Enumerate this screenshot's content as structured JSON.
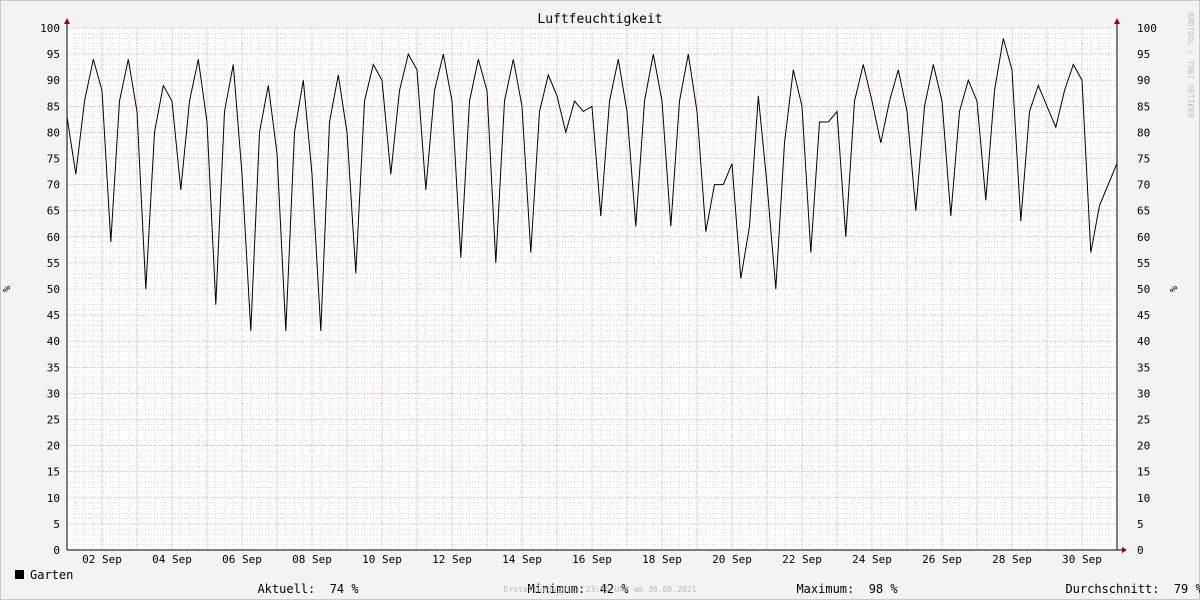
{
  "chart_data": {
    "type": "line",
    "title": "Luftfeuchtigkeit",
    "ylabel": "%",
    "ylabel_right": "%",
    "ylim": [
      0,
      100
    ],
    "xlim": [
      "2021-09-01",
      "2021-10-01"
    ],
    "y_ticks": [
      0,
      5,
      10,
      15,
      20,
      25,
      30,
      35,
      40,
      45,
      50,
      55,
      60,
      65,
      70,
      75,
      80,
      85,
      90,
      95,
      100
    ],
    "x_ticks": [
      {
        "date": "2021-09-02",
        "label": "02 Sep"
      },
      {
        "date": "2021-09-04",
        "label": "04 Sep"
      },
      {
        "date": "2021-09-06",
        "label": "06 Sep"
      },
      {
        "date": "2021-09-08",
        "label": "08 Sep"
      },
      {
        "date": "2021-09-10",
        "label": "10 Sep"
      },
      {
        "date": "2021-09-12",
        "label": "12 Sep"
      },
      {
        "date": "2021-09-14",
        "label": "14 Sep"
      },
      {
        "date": "2021-09-16",
        "label": "16 Sep"
      },
      {
        "date": "2021-09-18",
        "label": "18 Sep"
      },
      {
        "date": "2021-09-20",
        "label": "20 Sep"
      },
      {
        "date": "2021-09-22",
        "label": "22 Sep"
      },
      {
        "date": "2021-09-24",
        "label": "24 Sep"
      },
      {
        "date": "2021-09-26",
        "label": "26 Sep"
      },
      {
        "date": "2021-09-28",
        "label": "28 Sep"
      },
      {
        "date": "2021-09-30",
        "label": "30 Sep"
      }
    ],
    "grid": true,
    "series": [
      {
        "name": "Garten",
        "color": "#000000",
        "points": [
          [
            "2021-09-01 00:00",
            83
          ],
          [
            "2021-09-01 06:00",
            72
          ],
          [
            "2021-09-01 12:00",
            86
          ],
          [
            "2021-09-01 18:00",
            94
          ],
          [
            "2021-09-02 00:00",
            88
          ],
          [
            "2021-09-02 06:00",
            59
          ],
          [
            "2021-09-02 12:00",
            86
          ],
          [
            "2021-09-02 18:00",
            94
          ],
          [
            "2021-09-03 00:00",
            84
          ],
          [
            "2021-09-03 06:00",
            50
          ],
          [
            "2021-09-03 12:00",
            80
          ],
          [
            "2021-09-03 18:00",
            89
          ],
          [
            "2021-09-04 00:00",
            86
          ],
          [
            "2021-09-04 06:00",
            69
          ],
          [
            "2021-09-04 12:00",
            86
          ],
          [
            "2021-09-04 18:00",
            94
          ],
          [
            "2021-09-05 00:00",
            82
          ],
          [
            "2021-09-05 06:00",
            47
          ],
          [
            "2021-09-05 12:00",
            84
          ],
          [
            "2021-09-05 18:00",
            93
          ],
          [
            "2021-09-06 00:00",
            72
          ],
          [
            "2021-09-06 06:00",
            42
          ],
          [
            "2021-09-06 12:00",
            80
          ],
          [
            "2021-09-06 18:00",
            89
          ],
          [
            "2021-09-07 00:00",
            76
          ],
          [
            "2021-09-07 06:00",
            42
          ],
          [
            "2021-09-07 12:00",
            80
          ],
          [
            "2021-09-07 18:00",
            90
          ],
          [
            "2021-09-08 00:00",
            72
          ],
          [
            "2021-09-08 06:00",
            42
          ],
          [
            "2021-09-08 12:00",
            82
          ],
          [
            "2021-09-08 18:00",
            91
          ],
          [
            "2021-09-09 00:00",
            80
          ],
          [
            "2021-09-09 06:00",
            53
          ],
          [
            "2021-09-09 12:00",
            86
          ],
          [
            "2021-09-09 18:00",
            93
          ],
          [
            "2021-09-10 00:00",
            90
          ],
          [
            "2021-09-10 06:00",
            72
          ],
          [
            "2021-09-10 12:00",
            88
          ],
          [
            "2021-09-10 18:00",
            95
          ],
          [
            "2021-09-11 00:00",
            92
          ],
          [
            "2021-09-11 06:00",
            69
          ],
          [
            "2021-09-11 12:00",
            88
          ],
          [
            "2021-09-11 18:00",
            95
          ],
          [
            "2021-09-12 00:00",
            86
          ],
          [
            "2021-09-12 06:00",
            56
          ],
          [
            "2021-09-12 12:00",
            86
          ],
          [
            "2021-09-12 18:00",
            94
          ],
          [
            "2021-09-13 00:00",
            88
          ],
          [
            "2021-09-13 06:00",
            55
          ],
          [
            "2021-09-13 12:00",
            86
          ],
          [
            "2021-09-13 18:00",
            94
          ],
          [
            "2021-09-14 00:00",
            85
          ],
          [
            "2021-09-14 06:00",
            57
          ],
          [
            "2021-09-14 12:00",
            84
          ],
          [
            "2021-09-14 18:00",
            91
          ],
          [
            "2021-09-15 00:00",
            87
          ],
          [
            "2021-09-15 06:00",
            80
          ],
          [
            "2021-09-15 12:00",
            86
          ],
          [
            "2021-09-15 18:00",
            84
          ],
          [
            "2021-09-16 00:00",
            85
          ],
          [
            "2021-09-16 06:00",
            64
          ],
          [
            "2021-09-16 12:00",
            86
          ],
          [
            "2021-09-16 18:00",
            94
          ],
          [
            "2021-09-17 00:00",
            84
          ],
          [
            "2021-09-17 06:00",
            62
          ],
          [
            "2021-09-17 12:00",
            86
          ],
          [
            "2021-09-17 18:00",
            95
          ],
          [
            "2021-09-18 00:00",
            86
          ],
          [
            "2021-09-18 06:00",
            62
          ],
          [
            "2021-09-18 12:00",
            86
          ],
          [
            "2021-09-18 18:00",
            95
          ],
          [
            "2021-09-19 00:00",
            84
          ],
          [
            "2021-09-19 06:00",
            61
          ],
          [
            "2021-09-19 12:00",
            70
          ],
          [
            "2021-09-19 18:00",
            70
          ],
          [
            "2021-09-20 00:00",
            74
          ],
          [
            "2021-09-20 06:00",
            52
          ],
          [
            "2021-09-20 12:00",
            62
          ],
          [
            "2021-09-20 18:00",
            87
          ],
          [
            "2021-09-21 00:00",
            70
          ],
          [
            "2021-09-21 06:00",
            50
          ],
          [
            "2021-09-21 12:00",
            78
          ],
          [
            "2021-09-21 18:00",
            92
          ],
          [
            "2021-09-22 00:00",
            85
          ],
          [
            "2021-09-22 06:00",
            57
          ],
          [
            "2021-09-22 12:00",
            82
          ],
          [
            "2021-09-22 18:00",
            82
          ],
          [
            "2021-09-23 00:00",
            84
          ],
          [
            "2021-09-23 06:00",
            60
          ],
          [
            "2021-09-23 12:00",
            86
          ],
          [
            "2021-09-23 18:00",
            93
          ],
          [
            "2021-09-24 00:00",
            86
          ],
          [
            "2021-09-24 06:00",
            78
          ],
          [
            "2021-09-24 12:00",
            86
          ],
          [
            "2021-09-24 18:00",
            92
          ],
          [
            "2021-09-25 00:00",
            84
          ],
          [
            "2021-09-25 06:00",
            65
          ],
          [
            "2021-09-25 12:00",
            85
          ],
          [
            "2021-09-25 18:00",
            93
          ],
          [
            "2021-09-26 00:00",
            86
          ],
          [
            "2021-09-26 06:00",
            64
          ],
          [
            "2021-09-26 12:00",
            84
          ],
          [
            "2021-09-26 18:00",
            90
          ],
          [
            "2021-09-27 00:00",
            86
          ],
          [
            "2021-09-27 06:00",
            67
          ],
          [
            "2021-09-27 12:00",
            88
          ],
          [
            "2021-09-27 18:00",
            98
          ],
          [
            "2021-09-28 00:00",
            92
          ],
          [
            "2021-09-28 06:00",
            63
          ],
          [
            "2021-09-28 12:00",
            84
          ],
          [
            "2021-09-28 18:00",
            89
          ],
          [
            "2021-09-29 00:00",
            85
          ],
          [
            "2021-09-29 06:00",
            81
          ],
          [
            "2021-09-29 12:00",
            88
          ],
          [
            "2021-09-29 18:00",
            93
          ],
          [
            "2021-09-30 00:00",
            90
          ],
          [
            "2021-09-30 06:00",
            57
          ],
          [
            "2021-09-30 12:00",
            66
          ],
          [
            "2021-09-30 23:55",
            74
          ]
        ]
      }
    ]
  },
  "legend": {
    "series_name": "Garten",
    "aktuell_label": "Aktuell:",
    "aktuell_value": "74 %",
    "minimum_label": "Minimum:",
    "minimum_value": "42 %",
    "maximum_label": "Maximum:",
    "maximum_value": "98 %",
    "durchschnitt_label": "Durchschnitt:",
    "durchschnitt_value": "79 %"
  },
  "footer": "Erstellungszeit: 23:55 Uhr am 30.09.2021",
  "watermark": "RRDTOOL / TOBI OETIKER",
  "colors": {
    "background": "#f3f3f3",
    "plot_background": "#ffffff",
    "major_grid": "#e88a8a",
    "minor_grid": "#bdbdbd",
    "axis_arrow": "#a00000",
    "line": "#000000"
  }
}
